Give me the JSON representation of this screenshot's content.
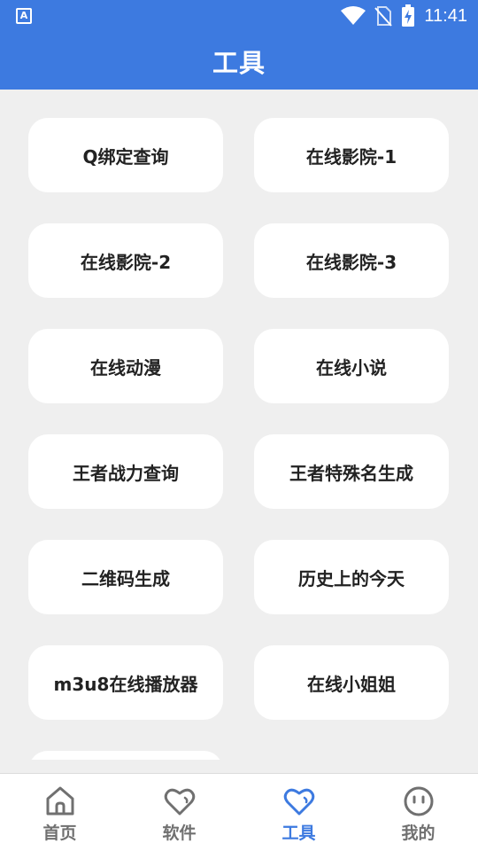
{
  "status_bar": {
    "app_badge": "A",
    "time": "11:41",
    "icons": [
      "wifi-icon",
      "no-sim-icon",
      "battery-charging-icon"
    ]
  },
  "app_bar": {
    "title": "工具"
  },
  "tools": [
    "Q绑定查询",
    "在线影院-1",
    "在线影院-2",
    "在线影院-3",
    "在线动漫",
    "在线小说",
    "王者战力查询",
    "王者特殊名生成",
    "二维码生成",
    "历史上的今天",
    "m3u8在线播放器",
    "在线小姐姐",
    ""
  ],
  "bottom_nav": {
    "active_color": "#3d7ae0",
    "inactive_color": "#707070",
    "items": [
      {
        "label": "首页",
        "icon": "home-icon",
        "active": false
      },
      {
        "label": "软件",
        "icon": "heart-icon",
        "active": false
      },
      {
        "label": "工具",
        "icon": "heart-icon",
        "active": true
      },
      {
        "label": "我的",
        "icon": "face-icon",
        "active": false
      }
    ]
  }
}
